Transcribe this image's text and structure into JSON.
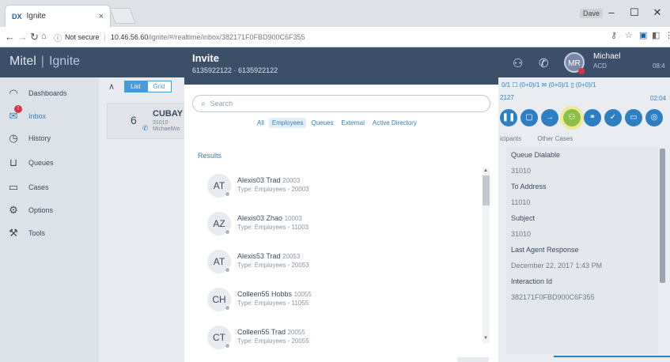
{
  "browser": {
    "tab_title": "Ignite",
    "tab_close": "×",
    "favicon": "DX",
    "user_chip": "Dave",
    "win_min": "–",
    "win_max": "☐",
    "win_close": "✕",
    "security_label": "Not secure",
    "host": "10.46.56.60",
    "path": "/ignite/#/realtime/inbox/382171F0FBD900C6F355"
  },
  "brand": {
    "name": "Mitel",
    "product": "Ignite"
  },
  "sidebar": {
    "items": [
      {
        "label": "Dashboards",
        "icon": "dashboard-icon"
      },
      {
        "label": "Inbox",
        "icon": "inbox-icon"
      },
      {
        "label": "History",
        "icon": "history-icon"
      },
      {
        "label": "Queues",
        "icon": "queues-icon"
      },
      {
        "label": "Cases",
        "icon": "cases-icon"
      },
      {
        "label": "Options",
        "icon": "gear-icon"
      },
      {
        "label": "Tools",
        "icon": "wrench-icon"
      }
    ]
  },
  "listpane": {
    "toggle_list": "List",
    "toggle_grid": "Grid",
    "conversation": {
      "count": "6",
      "name": "CUBAY",
      "line1": "31010",
      "line2": "MichaelWo"
    }
  },
  "user": {
    "initials": "MR",
    "name": "Michael",
    "role": "ACD",
    "clock": "08:4"
  },
  "right_panel": {
    "counters": "0/1  ☐ (0+0)/1  ✉ (0+0)/1  ▯ (0+0)/1",
    "interaction_short_id": "2127",
    "elapsed": "02:04",
    "tabs": [
      "icipants",
      "Other Cases"
    ],
    "details": [
      {
        "label": "Queue Dialable",
        "value": "31010"
      },
      {
        "label": "To Address",
        "value": "11010"
      },
      {
        "label": "Subject",
        "value": "31010"
      },
      {
        "label": "Last Agent Response",
        "value": "December 22, 2017 1:43 PM"
      },
      {
        "label": "Interaction Id",
        "value": "382171F0FBD900C6F355"
      }
    ]
  },
  "modal": {
    "title": "Invite",
    "subtitle": "6135922122 · 6135922122",
    "search_placeholder": "Search",
    "filters": [
      "All",
      "Employees",
      "Queues",
      "External",
      "Active Directory"
    ],
    "active_filter": "Employees",
    "results_label": "Results",
    "results": [
      {
        "initials": "AT",
        "name": "Alexis03 Trad",
        "ext": "20003",
        "type": "Type: Employees -  20003"
      },
      {
        "initials": "AZ",
        "name": "Alexis03 Zhao",
        "ext": "10003",
        "type": "Type: Employees -  11003"
      },
      {
        "initials": "AT",
        "name": "Alexis53 Trad",
        "ext": "20053",
        "type": "Type: Employees -  20053"
      },
      {
        "initials": "CH",
        "name": "Colleen55 Hobbs",
        "ext": "10055",
        "type": "Type: Employees -  11055"
      },
      {
        "initials": "CT",
        "name": "Colleen55 Trad",
        "ext": "20055",
        "type": "Type: Employees -  20055"
      }
    ]
  },
  "colors": {
    "header": "#3c4f69",
    "accent": "#2d7fc1",
    "highlight": "#8bbf47",
    "badge": "#d9304c"
  }
}
